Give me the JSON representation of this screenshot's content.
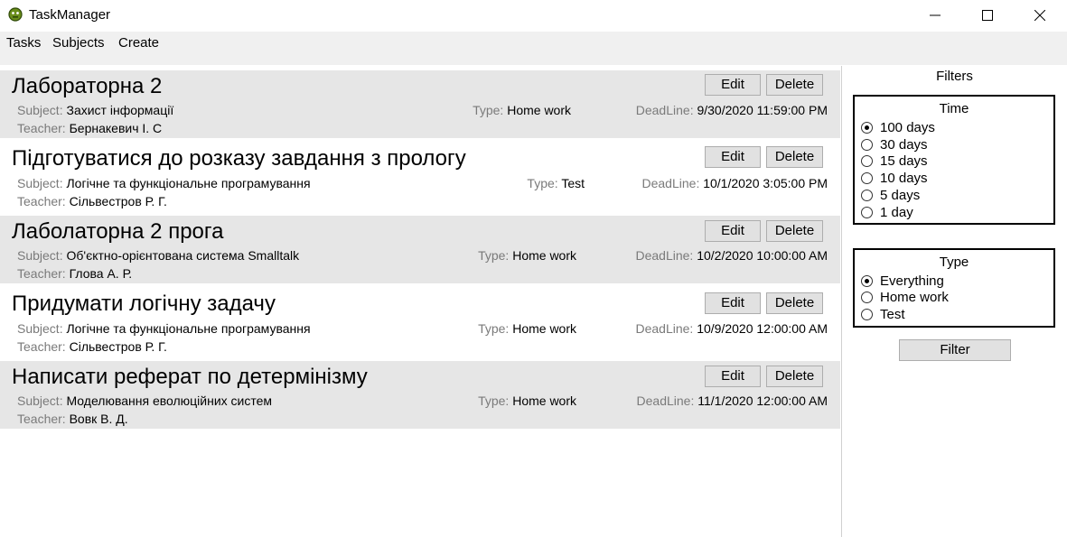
{
  "window": {
    "title": "TaskManager",
    "controls": {
      "minimize_icon": "minimize-icon",
      "maximize_icon": "maximize-icon",
      "close_icon": "close-icon"
    }
  },
  "menu": [
    "Tasks",
    "Subjects",
    "Create"
  ],
  "labels": {
    "subject": "Subject:",
    "teacher": "Teacher:",
    "type": "Type:",
    "deadline": "DeadLine:",
    "edit": "Edit",
    "delete": "Delete"
  },
  "tasks": [
    {
      "title": "Лабораторна 2",
      "subject": "Захист інформації",
      "teacher": "Бернакевич І. С",
      "type": "Home work",
      "deadline": "9/30/2020 11:59:00 PM"
    },
    {
      "title": "Підготуватися до розказу завдання з прологу",
      "subject": "Логічне та функціональне програмування",
      "teacher": "Сільвестров Р. Г.",
      "type": "Test",
      "deadline": "10/1/2020 3:05:00 PM"
    },
    {
      "title": "Лаболаторна 2 прога",
      "subject": "Об'єктно-орієнтована система Smalltalk",
      "teacher": "Глова А. Р.",
      "type": "Home work",
      "deadline": "10/2/2020 10:00:00 AM"
    },
    {
      "title": "Придумати логічну задачу",
      "subject": "Логічне та функціональне програмування",
      "teacher": "Сільвестров Р. Г.",
      "type": "Home work",
      "deadline": "10/9/2020 12:00:00 AM"
    },
    {
      "title": "Написати реферат по детермінізму",
      "subject": "Моделювання еволюційних систем",
      "teacher": "Вовк В. Д.",
      "type": "Home work",
      "deadline": "11/1/2020 12:00:00 AM"
    }
  ],
  "filters": {
    "title": "Filters",
    "time": {
      "title": "Time",
      "options": [
        "100 days",
        "30 days",
        "15 days",
        "10 days",
        "5 days",
        "1 day"
      ],
      "selected": "100 days"
    },
    "type": {
      "title": "Type",
      "options": [
        "Everything",
        "Home work",
        "Test"
      ],
      "selected": "Everything"
    },
    "button": "Filter"
  }
}
